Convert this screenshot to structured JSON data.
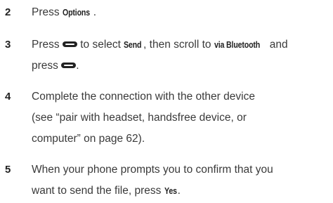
{
  "steps": [
    {
      "number": "2",
      "parts": [
        "Press ",
        "Options",
        "."
      ]
    },
    {
      "number": "3",
      "parts": [
        "Press ",
        " to select ",
        "Send",
        ", then scroll to ",
        "via Bluetooth",
        " and",
        "press ",
        "."
      ]
    },
    {
      "number": "4",
      "lines": [
        "Complete the connection with the other device",
        "(see “pair with headset, handsfree device, or",
        "computer” on page 62)."
      ]
    },
    {
      "number": "5",
      "parts": [
        "When your phone prompts you to confirm that you",
        "want to send the file, press ",
        "Yes",
        "."
      ]
    }
  ],
  "icons": {
    "center_key": "center-select-key-icon"
  }
}
